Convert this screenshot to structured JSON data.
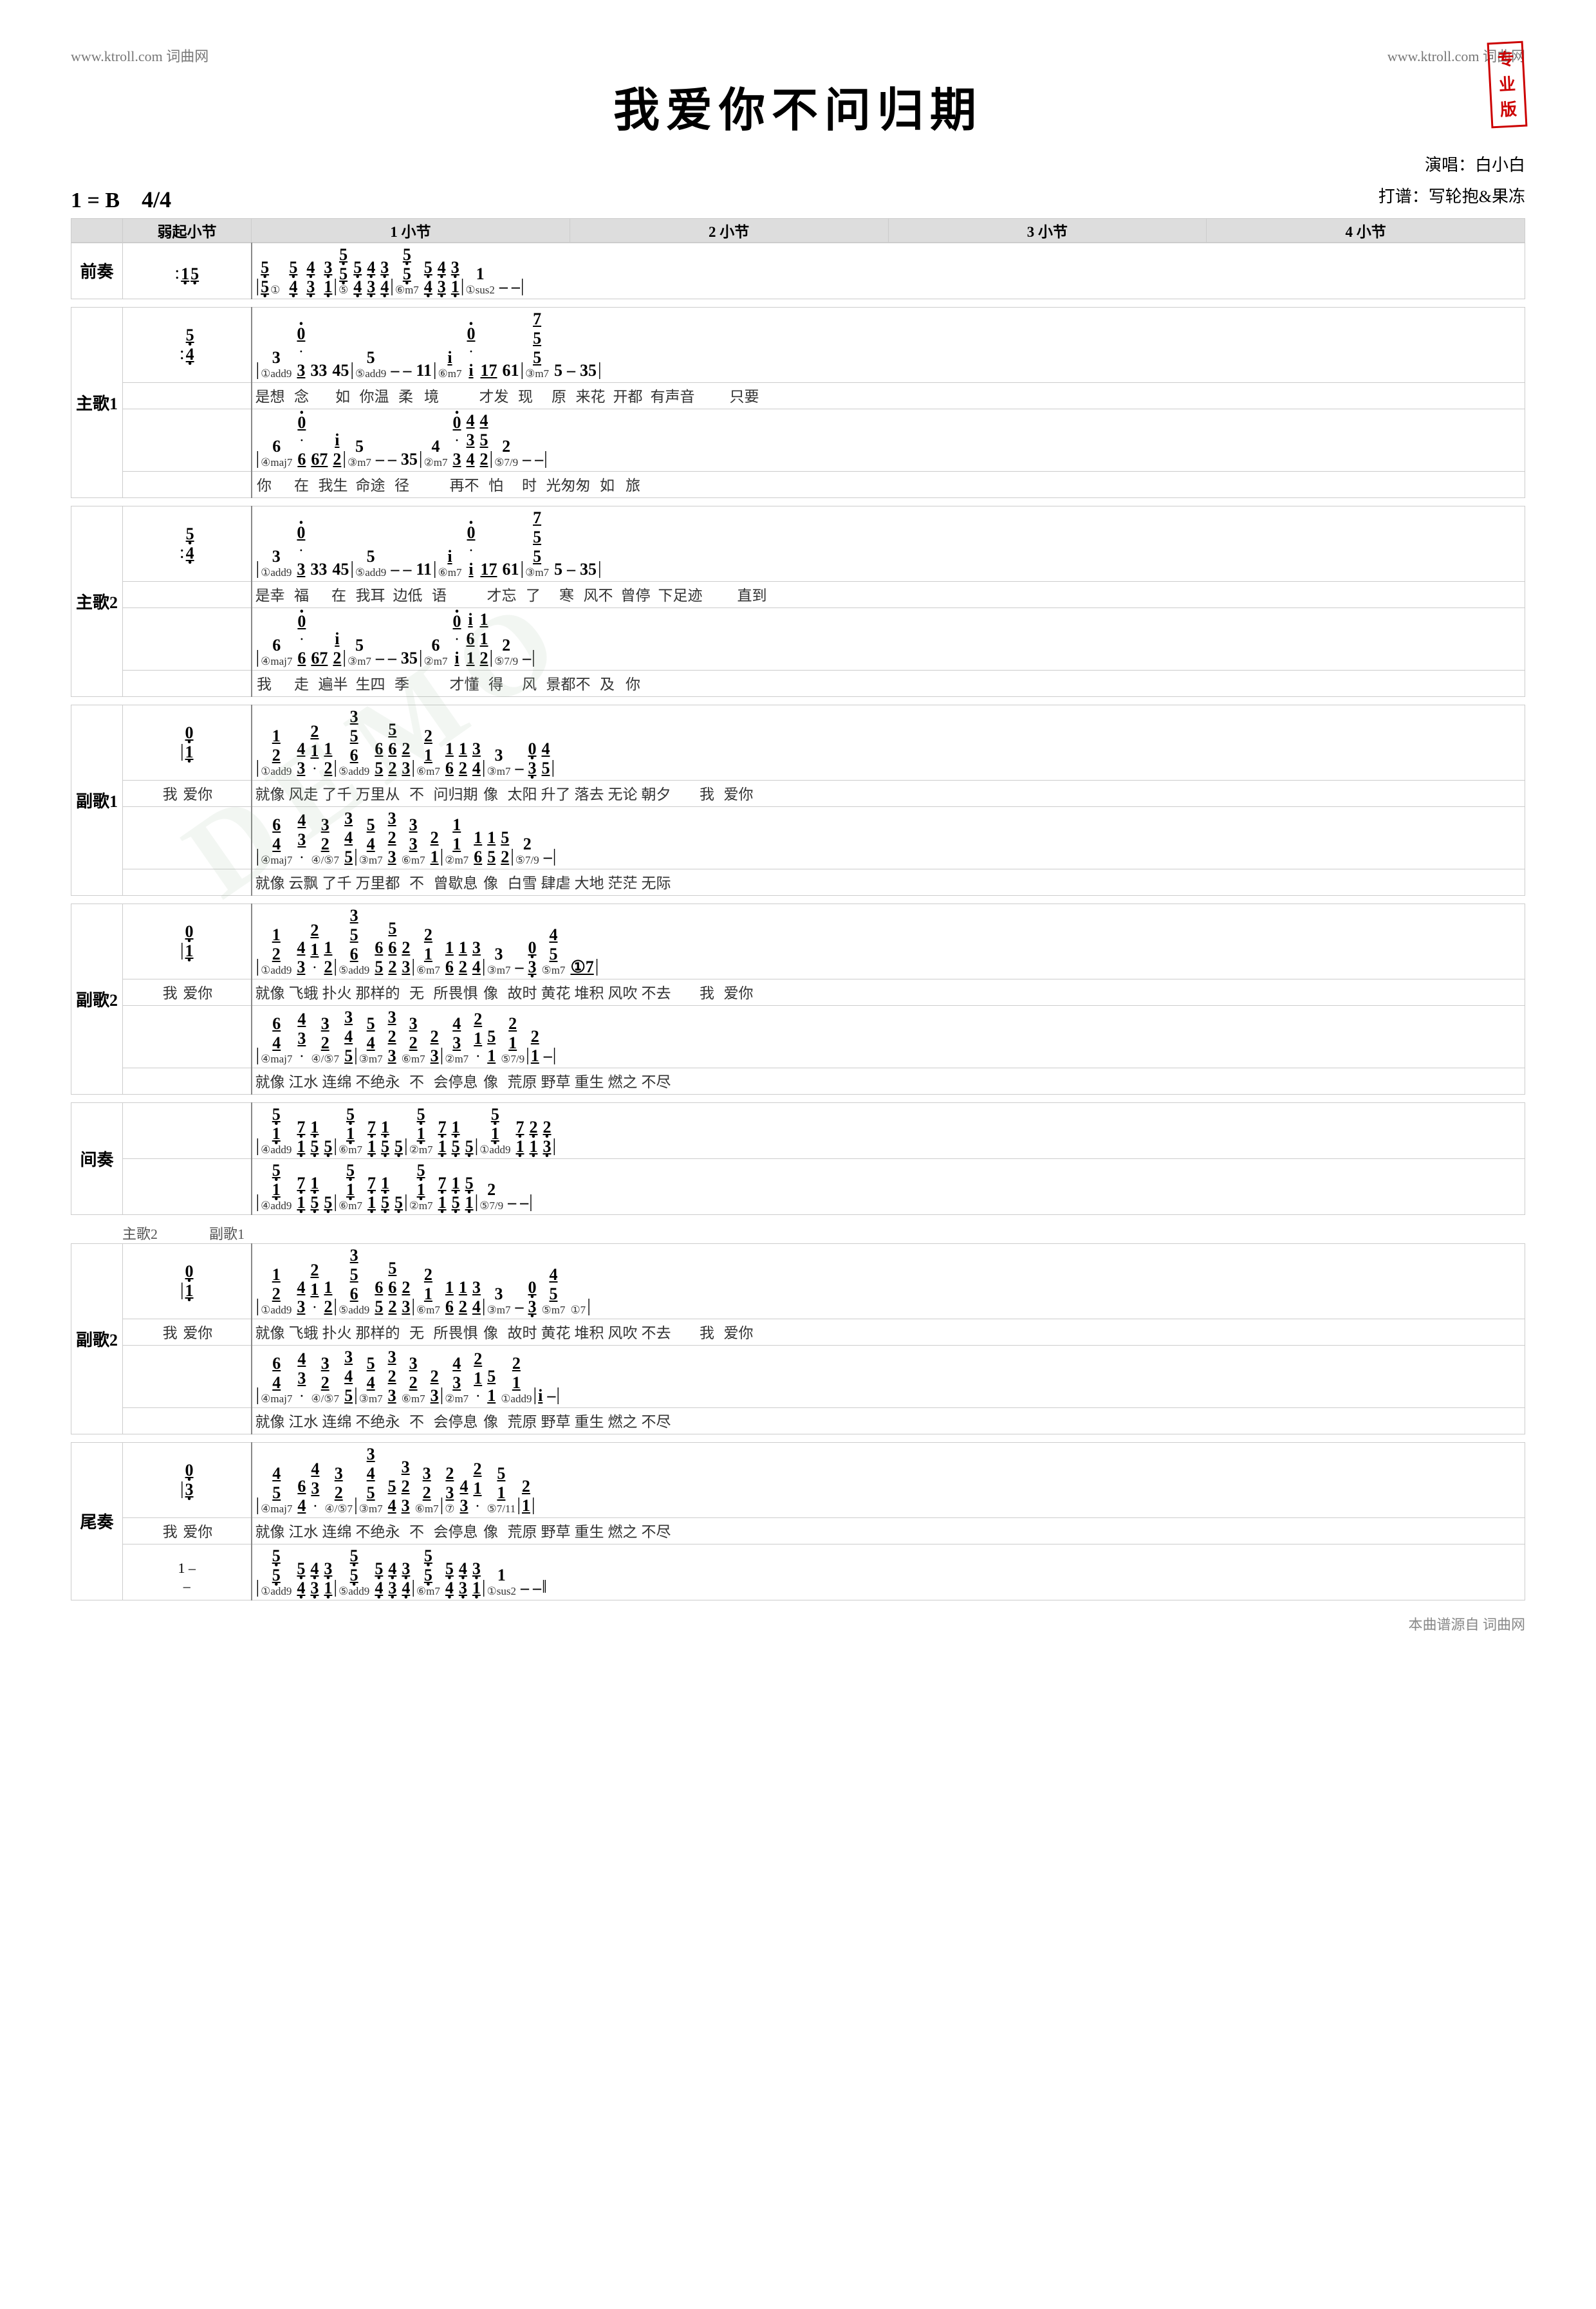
{
  "page": {
    "title": "我爱你不问归期",
    "key": "1 = B",
    "time_sig": "4/4",
    "performer_label": "演唱：白小白",
    "arranger_label": "打谱：写轮抱&果冻",
    "stamp_line1": "专",
    "stamp_line2": "业",
    "stamp_line3": "版",
    "logo_left": "www.ktroll.com 词曲网",
    "logo_right": "www.ktroll.com 词曲网",
    "attribution": "本曲谱源自 词曲网",
    "watermark": "DEMO"
  },
  "headers": {
    "weak_bar": "弱起小节",
    "bar1": "1 小节",
    "bar2": "2 小节",
    "bar3": "3 小节",
    "bar4": "4 小节"
  },
  "sections": {
    "prelude": "前奏",
    "verse1": "主歌1",
    "verse2": "主歌2",
    "chorus1": "副歌1",
    "chorus2": "副歌2",
    "interlude": "间奏",
    "outro": "尾奏"
  }
}
